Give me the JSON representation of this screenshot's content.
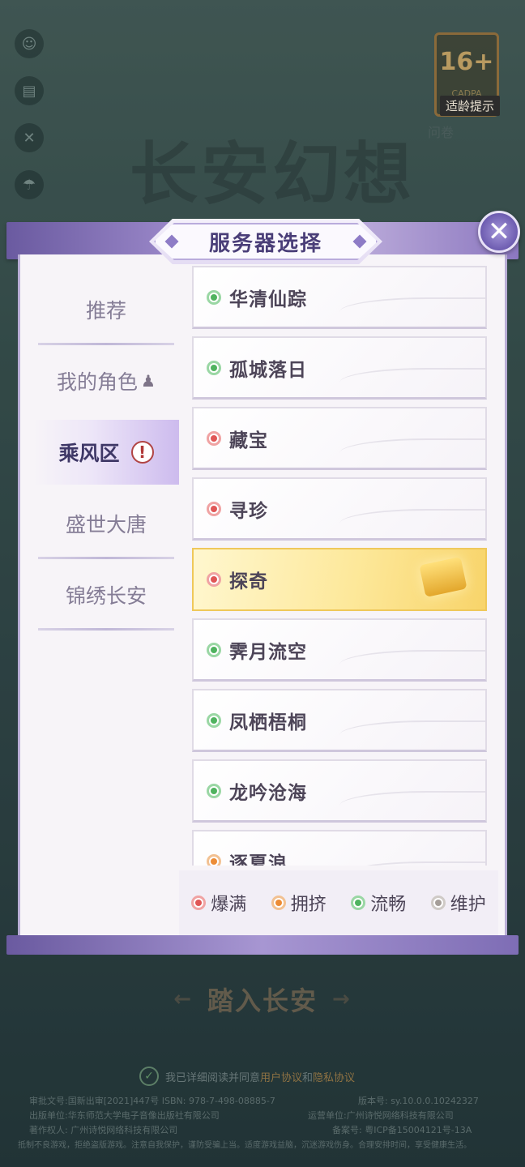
{
  "background": {
    "game_title": "长安幻想",
    "age_badge": {
      "rating": "16+",
      "cadpa": "CADPA",
      "tip": "适龄提示",
      "sub": "问卷"
    },
    "side_icons": [
      "character-icon",
      "book-icon",
      "tools-icon",
      "umbrella-icon"
    ]
  },
  "modal": {
    "title": "服务器选择",
    "close_label": "✕"
  },
  "sidebar": {
    "items": [
      {
        "label": "推荐"
      },
      {
        "label": "我的角色"
      },
      {
        "label": "乘风区",
        "alert": "!"
      },
      {
        "label": "盛世大唐"
      },
      {
        "label": "锦绣长安"
      }
    ]
  },
  "servers": [
    {
      "name": "华清仙踪",
      "status": "流畅"
    },
    {
      "name": "孤城落日",
      "status": "流畅"
    },
    {
      "name": "藏宝",
      "status": "爆满"
    },
    {
      "name": "寻珍",
      "status": "爆满"
    },
    {
      "name": "探奇",
      "status": "爆满"
    },
    {
      "name": "霁月流空",
      "status": "流畅"
    },
    {
      "name": "凤栖梧桐",
      "status": "流畅"
    },
    {
      "name": "龙吟沧海",
      "status": "流畅"
    },
    {
      "name": "逐夏浪",
      "status": "拥挤"
    }
  ],
  "legend": [
    {
      "label": "爆满",
      "color": "#e05656"
    },
    {
      "label": "拥挤",
      "color": "#ec8c36"
    },
    {
      "label": "流畅",
      "color": "#4fb35f"
    },
    {
      "label": "维护",
      "color": "#a59e99"
    }
  ],
  "enter_button": "踏入长安",
  "agreement": {
    "prefix": "我已详细阅读并同意",
    "user_agreement": "用户协议",
    "and": "和",
    "privacy": "隐私协议"
  },
  "footer": {
    "approval": "审批文号:国新出审[2021]447号 ISBN: 978-7-498-08885-7",
    "version": "版本号: sy.10.0.0.10242327",
    "publisher": "出版单位:华东师范大学电子音像出版社有限公司",
    "operator": "运营单位:广州诗悦网络科技有限公司",
    "copyright": "著作权人: 广州诗悦网络科技有限公司",
    "icp": "备案号: 粤ICP备15004121号-13A",
    "notice": "抵制不良游戏，拒绝盗版游戏。注意自我保护，谨防受骗上当。适度游戏益脑，沉迷游戏伤身。合理安排时间，享受健康生活。"
  }
}
